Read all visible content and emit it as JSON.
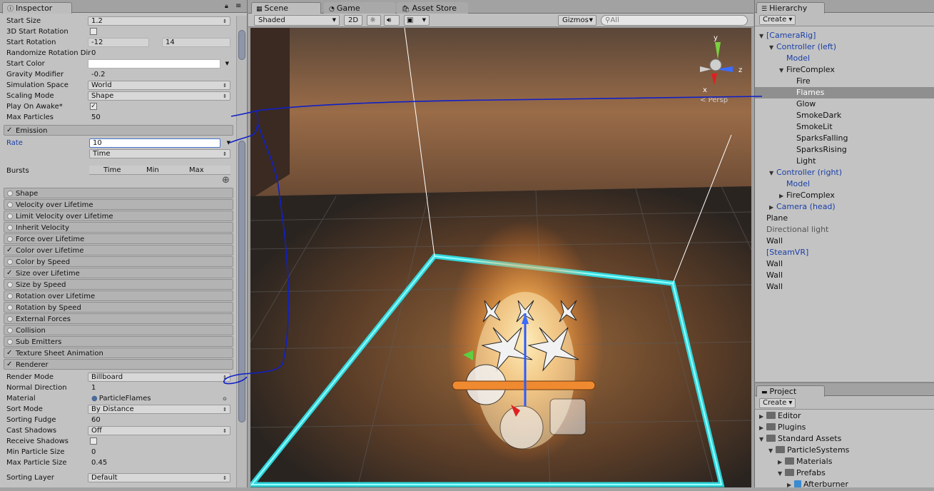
{
  "inspector": {
    "tab": "Inspector",
    "props_top": [
      {
        "label": "Start Size",
        "value": "1.2",
        "kind": "drop"
      },
      {
        "label": "3D Start Rotation",
        "value": "",
        "kind": "check"
      },
      {
        "label": "Start Rotation",
        "value": "-12",
        "value2": "14",
        "kind": "two"
      },
      {
        "label": "Randomize Rotation Dir",
        "value": "0",
        "kind": "plain"
      },
      {
        "label": "Start Color",
        "value": "",
        "kind": "color"
      },
      {
        "label": "Gravity Modifier",
        "value": "-0.2",
        "kind": "plain"
      },
      {
        "label": "Simulation Space",
        "value": "World",
        "kind": "drop"
      },
      {
        "label": "Scaling Mode",
        "value": "Shape",
        "kind": "drop"
      },
      {
        "label": "Play On Awake*",
        "value": "✓",
        "kind": "checked"
      },
      {
        "label": "Max Particles",
        "value": "50",
        "kind": "plain"
      }
    ],
    "emission": {
      "title": "Emission",
      "rate_label": "Rate",
      "rate_value": "10",
      "rate_mode": "Time",
      "bursts_label": "Bursts",
      "bursts_cols": [
        "Time",
        "Min",
        "Max"
      ]
    },
    "modules": [
      {
        "label": "Shape",
        "checked": false
      },
      {
        "label": "Velocity over Lifetime",
        "checked": false
      },
      {
        "label": "Limit Velocity over Lifetime",
        "checked": false
      },
      {
        "label": "Inherit Velocity",
        "checked": false
      },
      {
        "label": "Force over Lifetime",
        "checked": false
      },
      {
        "label": "Color over Lifetime",
        "checked": true
      },
      {
        "label": "Color by Speed",
        "checked": false
      },
      {
        "label": "Size over Lifetime",
        "checked": true
      },
      {
        "label": "Size by Speed",
        "checked": false
      },
      {
        "label": "Rotation over Lifetime",
        "checked": false
      },
      {
        "label": "Rotation by Speed",
        "checked": false
      },
      {
        "label": "External Forces",
        "checked": false
      },
      {
        "label": "Collision",
        "checked": false
      },
      {
        "label": "Sub Emitters",
        "checked": false
      },
      {
        "label": "Texture Sheet Animation",
        "checked": true
      },
      {
        "label": "Renderer",
        "checked": true
      }
    ],
    "renderer_props": [
      {
        "label": "Render Mode",
        "value": "Billboard",
        "kind": "drop"
      },
      {
        "label": "Normal Direction",
        "value": "1",
        "kind": "plain"
      },
      {
        "label": "Material",
        "value": "ParticleFlames",
        "kind": "obj"
      },
      {
        "label": "Sort Mode",
        "value": "By Distance",
        "kind": "drop"
      },
      {
        "label": "Sorting Fudge",
        "value": "60",
        "kind": "plain"
      },
      {
        "label": "Cast Shadows",
        "value": "Off",
        "kind": "drop"
      },
      {
        "label": "Receive Shadows",
        "value": "",
        "kind": "check"
      },
      {
        "label": "Min Particle Size",
        "value": "0",
        "kind": "plain"
      },
      {
        "label": "Max Particle Size",
        "value": "0.45",
        "kind": "plain"
      },
      {
        "label": "Sorting Layer",
        "value": "Default",
        "kind": "drop"
      }
    ]
  },
  "scene": {
    "tabs": [
      "Scene",
      "Game",
      "Asset Store"
    ],
    "shading": "Shaded",
    "mode2d": "2D",
    "gizmos": "Gizmos",
    "search_placeholder": "All",
    "persp": "Persp",
    "axis_x": "x",
    "axis_y": "y",
    "axis_z": "z"
  },
  "hierarchy": {
    "tab": "Hierarchy",
    "create": "Create",
    "items": [
      {
        "label": "[CameraRig]",
        "depth": 0,
        "tri": "▼",
        "style": "blue"
      },
      {
        "label": "Controller (left)",
        "depth": 1,
        "tri": "▼",
        "style": "blue"
      },
      {
        "label": "Model",
        "depth": 2,
        "tri": "",
        "style": "blue"
      },
      {
        "label": "FireComplex",
        "depth": 2,
        "tri": "▼",
        "style": ""
      },
      {
        "label": "Fire",
        "depth": 3,
        "tri": "",
        "style": ""
      },
      {
        "label": "Flames",
        "depth": 3,
        "tri": "",
        "style": "sel"
      },
      {
        "label": "Glow",
        "depth": 3,
        "tri": "",
        "style": ""
      },
      {
        "label": "SmokeDark",
        "depth": 3,
        "tri": "",
        "style": ""
      },
      {
        "label": "SmokeLit",
        "depth": 3,
        "tri": "",
        "style": ""
      },
      {
        "label": "SparksFalling",
        "depth": 3,
        "tri": "",
        "style": ""
      },
      {
        "label": "SparksRising",
        "depth": 3,
        "tri": "",
        "style": ""
      },
      {
        "label": "Light",
        "depth": 3,
        "tri": "",
        "style": ""
      },
      {
        "label": "Controller (right)",
        "depth": 1,
        "tri": "▼",
        "style": "blue"
      },
      {
        "label": "Model",
        "depth": 2,
        "tri": "",
        "style": "blue"
      },
      {
        "label": "FireComplex",
        "depth": 2,
        "tri": "▶",
        "style": ""
      },
      {
        "label": "Camera (head)",
        "depth": 1,
        "tri": "▶",
        "style": "blue"
      },
      {
        "label": "Plane",
        "depth": 0,
        "tri": "",
        "style": ""
      },
      {
        "label": "Directional light",
        "depth": 0,
        "tri": "",
        "style": "grey"
      },
      {
        "label": "Wall",
        "depth": 0,
        "tri": "",
        "style": ""
      },
      {
        "label": "[SteamVR]",
        "depth": 0,
        "tri": "",
        "style": "blue"
      },
      {
        "label": "Wall",
        "depth": 0,
        "tri": "",
        "style": ""
      },
      {
        "label": "Wall",
        "depth": 0,
        "tri": "",
        "style": ""
      },
      {
        "label": "Wall",
        "depth": 0,
        "tri": "",
        "style": ""
      }
    ]
  },
  "project": {
    "tab": "Project",
    "create": "Create",
    "items": [
      {
        "label": "Editor",
        "depth": 0,
        "tri": "▶"
      },
      {
        "label": "Plugins",
        "depth": 0,
        "tri": "▶"
      },
      {
        "label": "Standard Assets",
        "depth": 0,
        "tri": "▼"
      },
      {
        "label": "ParticleSystems",
        "depth": 1,
        "tri": "▼"
      },
      {
        "label": "Materials",
        "depth": 2,
        "tri": "▶"
      },
      {
        "label": "Prefabs",
        "depth": 2,
        "tri": "▼"
      },
      {
        "label": "Afterburner",
        "depth": 3,
        "tri": "▶"
      }
    ]
  }
}
